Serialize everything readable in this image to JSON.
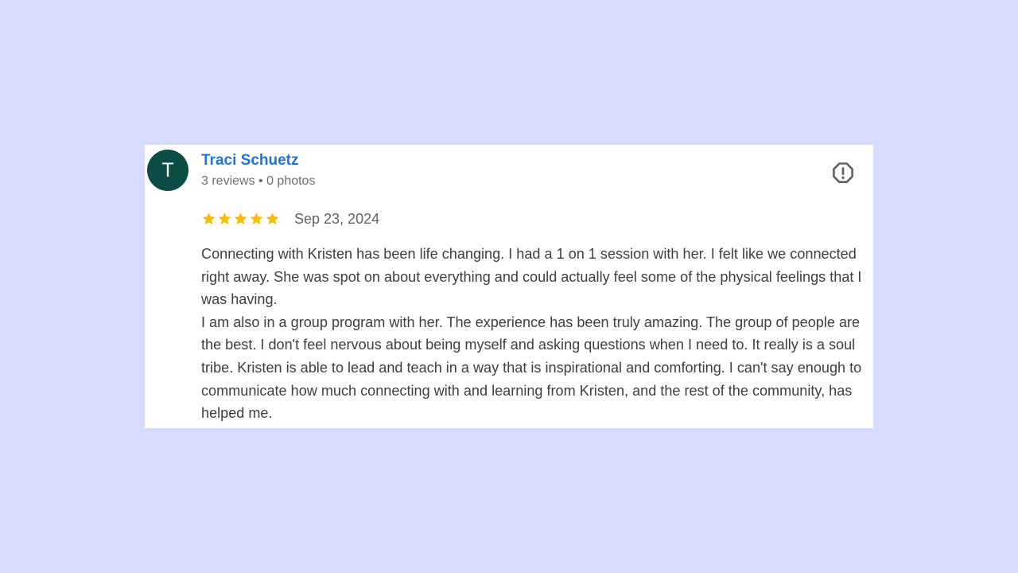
{
  "review": {
    "avatar_initial": "T",
    "reviewer_name": "Traci Schuetz",
    "reviewer_meta": "3 reviews • 0 photos",
    "rating": 5,
    "rating_max": 5,
    "date": "Sep 23, 2024",
    "paragraphs": [
      "Connecting with Kristen has been life changing. I had a 1 on 1 session with her. I felt like we connected right away. She was spot on about everything and could actually feel some of the physical feelings that I was having.",
      "I am also in a group program with her. The experience has been truly amazing. The group of people are the best. I don't feel nervous about being myself and asking questions when I need to. It really is a soul tribe. Kristen is able to lead and teach in a way that is inspirational and comforting. I can't say enough to communicate how much connecting with and learning from Kristen, and the rest of the community, has helped me."
    ],
    "report_icon": "report-flag-octagon-exclamation-icon"
  },
  "colors": {
    "page_background": "#d7dcfc",
    "card_background": "#ffffff",
    "avatar_background": "#0b4d45",
    "name_link": "#1a73e8",
    "star_fill": "#fbbc04",
    "body_text": "#3c4043",
    "meta_text": "#6b6e73"
  }
}
